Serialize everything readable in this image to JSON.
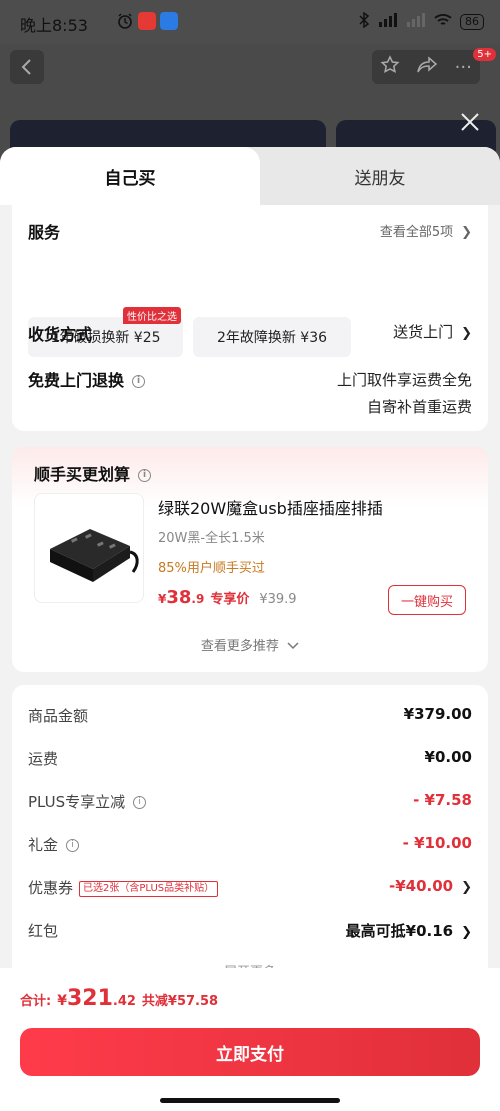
{
  "status": {
    "time": "晚上8:53",
    "battery": "86"
  },
  "nav": {
    "badge": "5+"
  },
  "tabs": [
    {
      "label": "自己买"
    },
    {
      "label": "送朋友"
    }
  ],
  "service": {
    "title": "服务",
    "view_all": "查看全部5项",
    "options": [
      {
        "label": "1年破损换新  ¥25",
        "tag": "性价比之选"
      },
      {
        "label": "2年故障换新  ¥36"
      }
    ],
    "delivery_title": "收货方式",
    "delivery_value": "送货上门",
    "return_title": "免费上门退换",
    "return_line1": "上门取件享运费全免",
    "return_line2": "自寄补首重运费"
  },
  "recommend": {
    "title": "顺手买更划算",
    "product_title": "绿联20W魔盒usb插座插座排插",
    "spec": "20W黑-全长1.5米",
    "users": "85%用户顺手买过",
    "price_currency": "¥",
    "price_int": "38",
    "price_dec": ".9",
    "price_label": "专享价",
    "orig_price": "¥39.9",
    "buy_label": "一键购买",
    "more": "查看更多推荐"
  },
  "summary": {
    "rows": [
      {
        "label": "商品金额",
        "value": "¥379.00"
      },
      {
        "label": "运费",
        "value": "¥0.00"
      },
      {
        "label": "PLUS专享立减",
        "value": "- ¥7.58"
      },
      {
        "label": "礼金",
        "value": "- ¥10.00"
      },
      {
        "label": "优惠券",
        "tag": "已选2张（含PLUS品类补贴）",
        "value": "-¥40.00"
      },
      {
        "label": "红包",
        "value": "最高可抵¥0.16"
      }
    ],
    "expand": "展开更多"
  },
  "bottom": {
    "total_label": "合计:",
    "total_currency": "¥",
    "total_int": "321",
    "total_dec": ".42",
    "saved": "共减¥57.58",
    "pay_label": "立即支付"
  },
  "colors": {
    "accent": "#e0303a",
    "coupon_note": "#c8781f"
  }
}
